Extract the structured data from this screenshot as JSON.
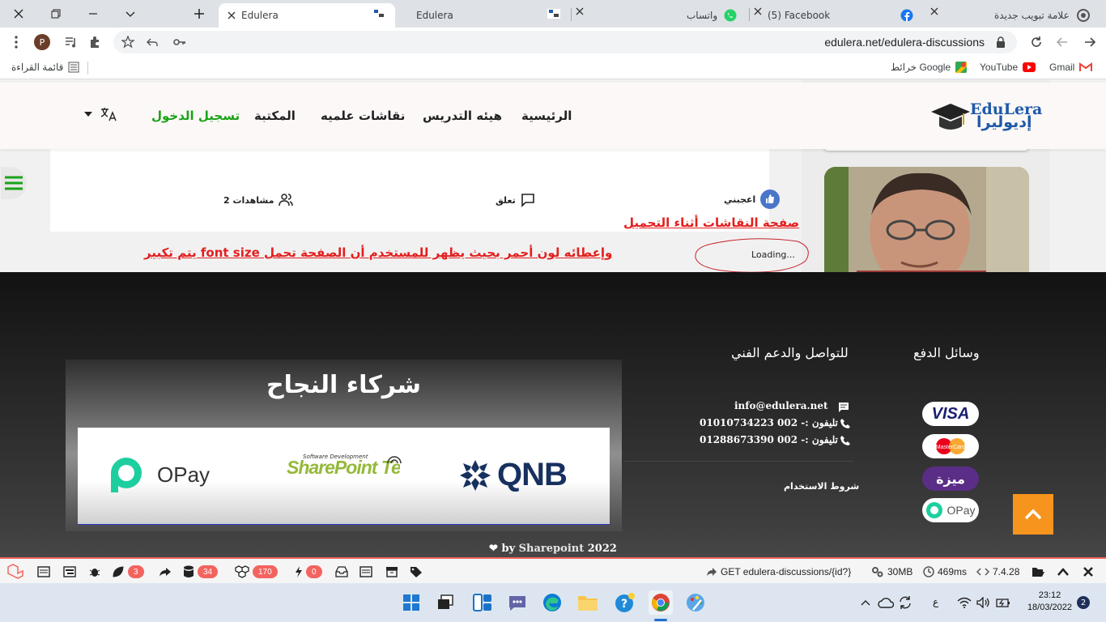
{
  "browser": {
    "tabs": [
      {
        "title": "Edulera",
        "active": true
      },
      {
        "title": "Edulera",
        "active": false
      },
      {
        "title": "واتساب",
        "active": false
      },
      {
        "title": "(5) Facebook",
        "active": false
      },
      {
        "title": "علامة تبويب جديدة",
        "active": false
      }
    ],
    "url": "edulera.net/edulera-discussions",
    "profile_initial": "P",
    "bookmarks": {
      "reading_list": "قائمة القراءة",
      "google_maps": "خرائط Google",
      "youtube": "YouTube",
      "gmail": "Gmail"
    }
  },
  "site": {
    "logo_en": "EduLera",
    "logo_ar": "إديوليرا",
    "nav": {
      "home": "الرئيسية",
      "faculty": "هيئه التدريس",
      "discussions": "نقاشات علميه",
      "library": "المكتبة",
      "login": "تسجيل الدخول"
    },
    "post": {
      "like": "اعجبني",
      "comment": "تعلق",
      "views": "2 مشاهدات"
    },
    "annotation_title": "صفحة النقاشات أثناء التحميل",
    "annotation_desc": "يتم تكبير  font size وإعطائه لون أحمر بحيث يظهر للمستخدم أن الصفحة تحمل   ",
    "loading": "Loading...",
    "footer": {
      "partners_title": "شركاء النجاح",
      "partners": [
        "OPay",
        "SharePoint Technology",
        "QNB"
      ],
      "partner_tagline": "Software Development",
      "support_heading": "للتواصل والدعم الفني",
      "payment_heading": "وسائل الدفع",
      "email": "info@edulera.net",
      "phone1": "تليفون :- 002 01010734223",
      "phone2": "تليفون :- 002 01288673390",
      "terms": "شروط الاستخدام",
      "payment_methods": [
        "VISA",
        "MasterCard",
        "ميزة",
        "OPay"
      ],
      "credit_by": "by",
      "credit_name": "Sharepoint",
      "credit_year": "2022"
    }
  },
  "debugbar": {
    "messages": "3",
    "queries": "34",
    "models": "170",
    "events": "0",
    "route": "GET edulera-discussions/{id?}",
    "memory": "30MB",
    "time": "469ms",
    "php": "7.4.28"
  },
  "taskbar": {
    "time": "23:12",
    "date": "18/03/2022",
    "lang": "ع",
    "notifications": "2"
  },
  "colors": {
    "annotation_red": "#e41e1e",
    "login_green": "#1aa317",
    "scroll_top_orange": "#f7941d",
    "debug_accent": "#f4645f"
  }
}
